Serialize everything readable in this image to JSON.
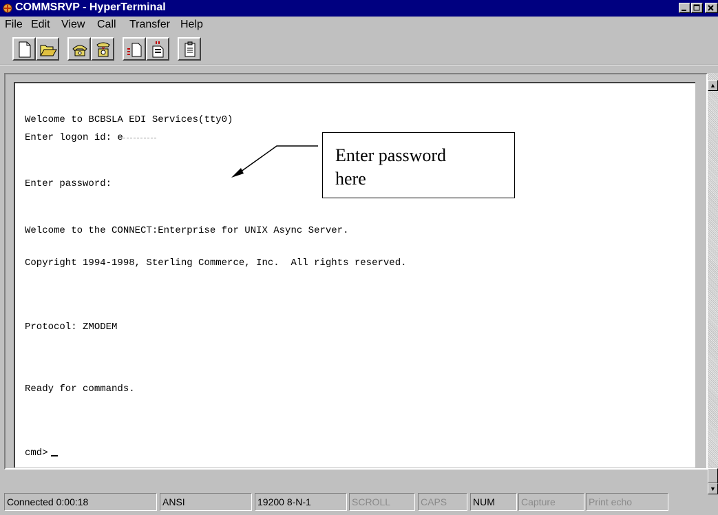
{
  "window": {
    "title": "COMMSRVP - HyperTerminal",
    "app_icon": "hyperterminal-icon"
  },
  "menu": [
    {
      "label": "File"
    },
    {
      "label": "Edit"
    },
    {
      "label": "View"
    },
    {
      "label": "Call"
    },
    {
      "label": "Transfer"
    },
    {
      "label": "Help"
    }
  ],
  "toolbar": [
    {
      "icon": "new-document-icon"
    },
    {
      "icon": "open-folder-icon"
    },
    {
      "icon": "call-phone-icon"
    },
    {
      "icon": "disconnect-phone-icon"
    },
    {
      "icon": "send-file-icon"
    },
    {
      "icon": "receive-file-icon"
    },
    {
      "icon": "properties-icon"
    }
  ],
  "terminal": {
    "lines": [
      "Welcome to BCBSLA EDI Services(tty0)",
      "Enter logon id: e",
      "Enter password:",
      "Welcome to the CONNECT:Enterprise for UNIX Async Server.",
      "Copyright 1994-1998, Sterling Commerce, Inc.  All rights reserved.",
      "Protocol: ZMODEM",
      "Ready for commands.",
      "cmd>"
    ]
  },
  "callout": {
    "line1": "Enter password",
    "line2": "here"
  },
  "status": {
    "connected": "Connected 0:00:18",
    "emulation": "ANSI",
    "settings": "19200 8-N-1",
    "scroll": "SCROLL",
    "caps": "CAPS",
    "num": "NUM",
    "capture": "Capture",
    "print_echo": "Print echo"
  }
}
